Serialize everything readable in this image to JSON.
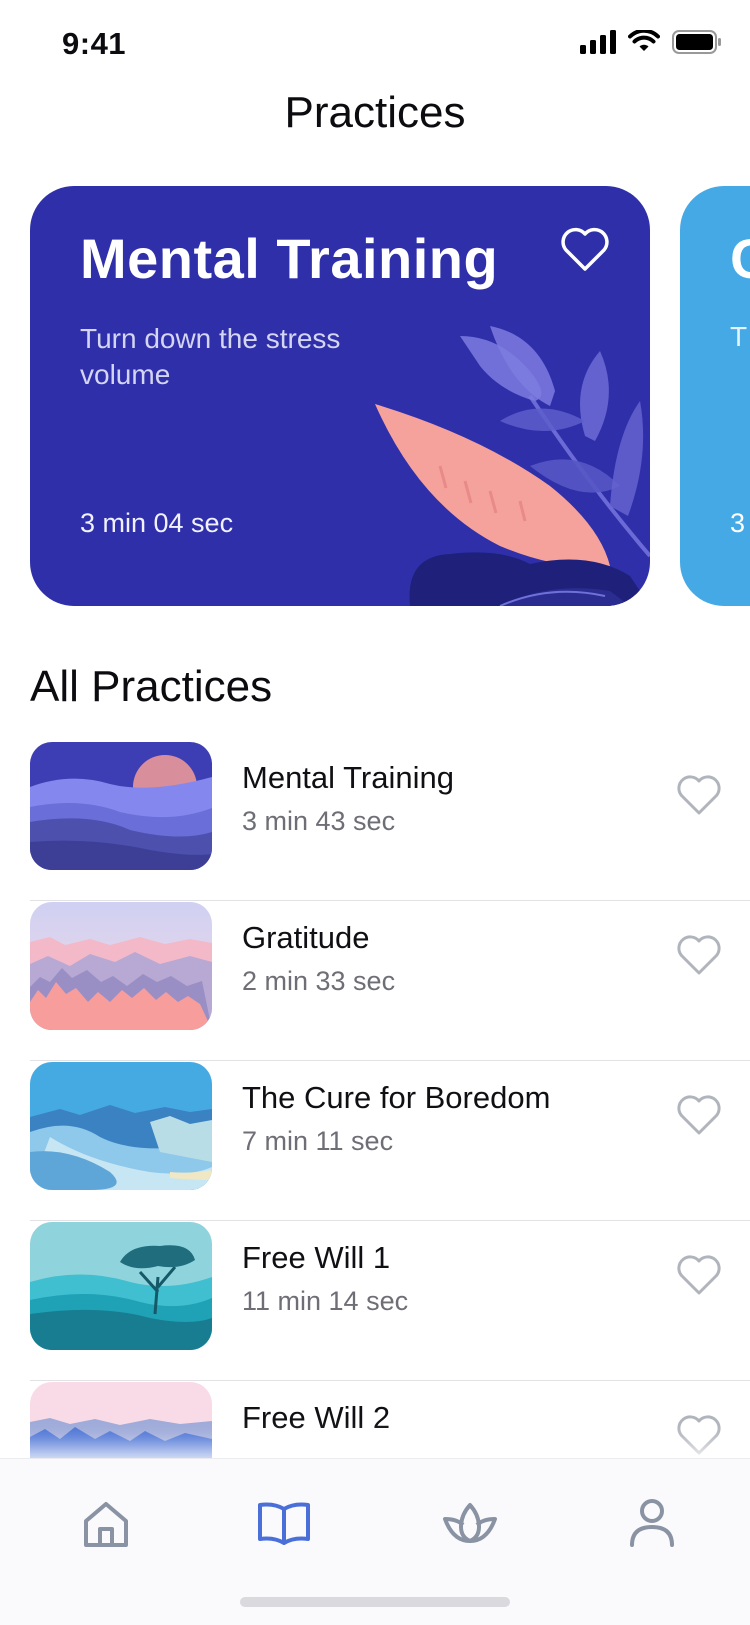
{
  "status_bar": {
    "time": "9:41"
  },
  "header": {
    "title": "Practices"
  },
  "featured": {
    "title": "Mental Training",
    "subtitle": "Turn down the stress volume",
    "duration": "3 min 04 sec",
    "background": "#2f30a9"
  },
  "featured_next": {
    "title": "C",
    "subtitle": "T",
    "duration": "3",
    "background": "#45a9e6"
  },
  "all_practices": {
    "title": "All Practices",
    "items": [
      {
        "title": "Mental Training",
        "duration": "3 min 43 sec"
      },
      {
        "title": "Gratitude",
        "duration": "2 min 33 sec"
      },
      {
        "title": "The Cure for Boredom",
        "duration": "7 min 11 sec"
      },
      {
        "title": "Free Will 1",
        "duration": "11 min 14 sec"
      },
      {
        "title": "Free Will 2",
        "duration": ""
      }
    ]
  },
  "tab_bar": {
    "tabs": [
      {
        "icon": "home-icon",
        "active": false
      },
      {
        "icon": "book-icon",
        "active": true
      },
      {
        "icon": "lotus-icon",
        "active": false
      },
      {
        "icon": "profile-icon",
        "active": false
      }
    ],
    "active_color": "#4a6fd8",
    "inactive_color": "#8a93a3"
  }
}
